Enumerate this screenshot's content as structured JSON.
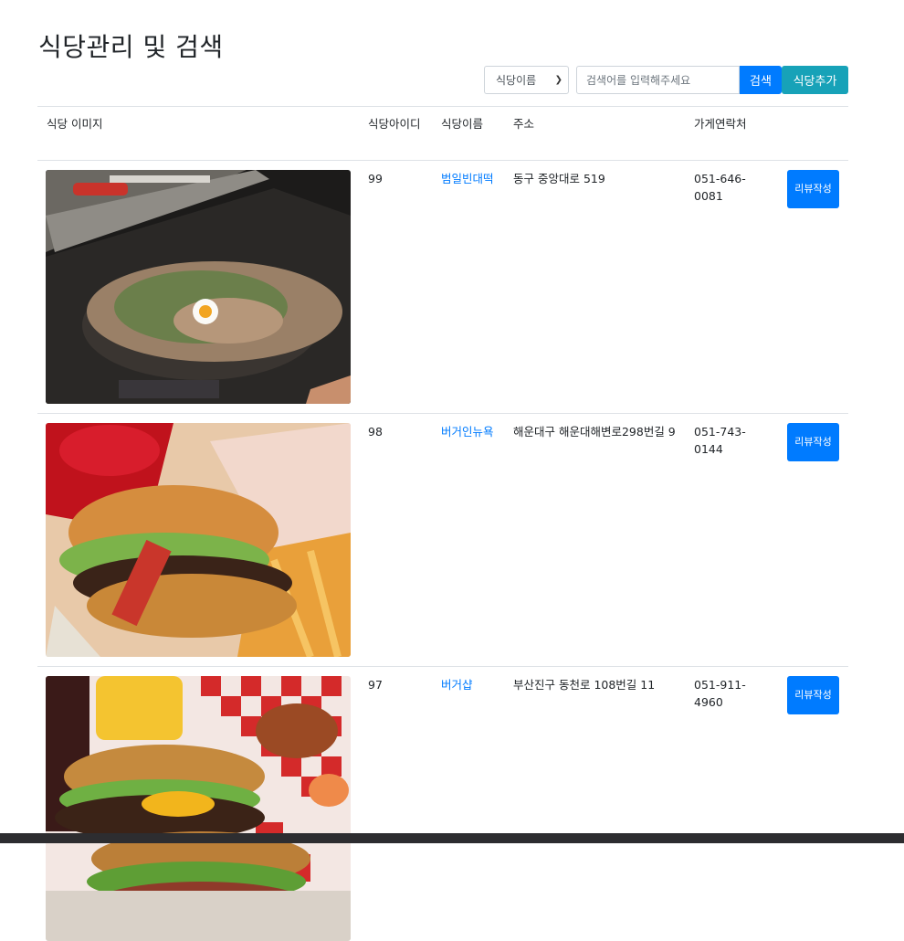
{
  "page": {
    "title": "식당관리 및 검색"
  },
  "search": {
    "select_value": "식당이름",
    "input_value": "",
    "input_placeholder": "검색어를 입력해주세요",
    "search_label": "검색",
    "add_label": "식당추가"
  },
  "table": {
    "columns": [
      "식당 이미지",
      "식당아이디",
      "식당이름",
      "주소",
      "가게연락처"
    ],
    "rows": [
      {
        "image": "food-photo-pajeon",
        "id": "99",
        "name": "범일빈대떡",
        "address": "동구 중앙대로 519",
        "phone": "051-646-0081",
        "action": "리뷰작성"
      },
      {
        "image": "food-photo-burger",
        "id": "98",
        "name": "버거인뉴욕",
        "address": "해운대구 해운대해변로298번길 9",
        "phone": "051-743-0144",
        "action": "리뷰작성"
      },
      {
        "image": "food-photo-burgers-basket",
        "id": "97",
        "name": "버거샵",
        "address": "부산진구 동천로 108번길 11",
        "phone": "051-911-4960",
        "action": "리뷰작성"
      }
    ]
  },
  "colors": {
    "primary": "#007bff",
    "info": "#17a2b8",
    "border": "#dee2e6",
    "text": "#212529"
  }
}
